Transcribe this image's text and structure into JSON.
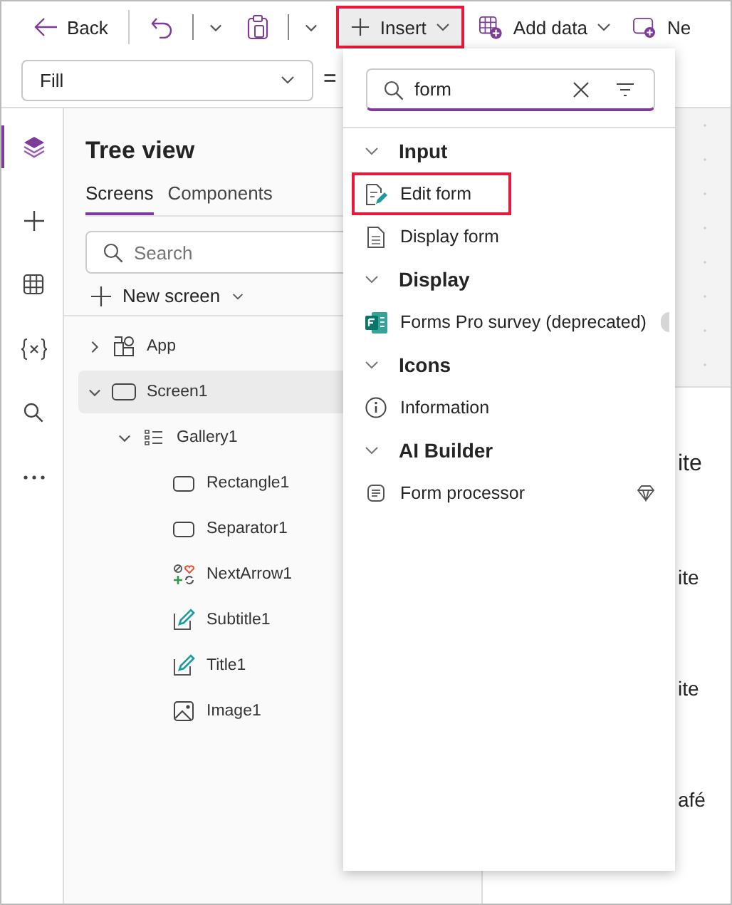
{
  "toolbar": {
    "back": "Back",
    "insert": {
      "label": "Insert",
      "highlighted": true
    },
    "add_data": "Add data",
    "new": "Ne"
  },
  "formula_bar": {
    "property": "Fill",
    "equals": "="
  },
  "rail": [
    {
      "kind": "layers",
      "selected": true
    },
    {
      "kind": "plus",
      "selected": false
    },
    {
      "kind": "table",
      "selected": false
    },
    {
      "kind": "variables",
      "selected": false
    },
    {
      "kind": "search",
      "selected": false
    },
    {
      "kind": "more",
      "selected": false
    }
  ],
  "tree_view": {
    "title": "Tree view",
    "tabs": [
      {
        "label": "Screens",
        "selected": true
      },
      {
        "label": "Components",
        "selected": false
      }
    ],
    "search": {
      "placeholder": "Search"
    },
    "new_screen": "New screen",
    "items": [
      {
        "label": "App",
        "kind": "app",
        "expanded": false,
        "selected": false
      },
      {
        "label": "Screen1",
        "kind": "screen",
        "expanded": true,
        "selected": true,
        "children": [
          {
            "label": "Gallery1",
            "kind": "gallery",
            "expanded": true,
            "selected": false,
            "children": [
              {
                "label": "Rectangle1",
                "kind": "rectangle",
                "selected": false
              },
              {
                "label": "Separator1",
                "kind": "rectangle",
                "selected": false
              },
              {
                "label": "NextArrow1",
                "kind": "icons",
                "selected": false
              },
              {
                "label": "Subtitle1",
                "kind": "label",
                "selected": false
              },
              {
                "label": "Title1",
                "kind": "label",
                "selected": false
              },
              {
                "label": "Image1",
                "kind": "image",
                "selected": false
              }
            ]
          }
        ]
      }
    ]
  },
  "insert_menu": {
    "search": {
      "value": "form"
    },
    "groups": [
      {
        "title": "Input",
        "expanded": true,
        "items": [
          {
            "label": "Edit form",
            "kind": "edit-form",
            "highlighted": true,
            "badge": false,
            "premium": false
          },
          {
            "label": "Display form",
            "kind": "display-form",
            "highlighted": false,
            "badge": false,
            "premium": false
          }
        ]
      },
      {
        "title": "Display",
        "expanded": true,
        "items": [
          {
            "label": "Forms Pro survey (deprecated)",
            "kind": "forms",
            "highlighted": false,
            "badge": true,
            "premium": false
          }
        ]
      },
      {
        "title": "Icons",
        "expanded": true,
        "items": [
          {
            "label": "Information",
            "kind": "info",
            "highlighted": false,
            "badge": false,
            "premium": false
          }
        ]
      },
      {
        "title": "AI Builder",
        "expanded": true,
        "items": [
          {
            "label": "Form processor",
            "kind": "processor",
            "highlighted": false,
            "badge": false,
            "premium": true
          }
        ]
      }
    ]
  },
  "canvas": {
    "gallery_texts": [
      {
        "text": "ite",
        "kind": "title"
      },
      {
        "text": "ite",
        "kind": "subtitle"
      },
      {
        "text": "ite",
        "kind": "subtitle"
      },
      {
        "text": "afé",
        "kind": "subtitle"
      }
    ]
  }
}
